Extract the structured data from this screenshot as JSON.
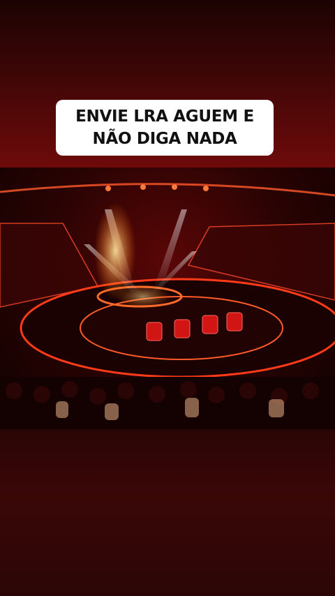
{
  "caption": {
    "text": "ENVIE LRA AGUEM E NÃO DIGA NADA"
  },
  "video": {
    "scene": "stage-with-audience",
    "colors": {
      "accent": "#ff3b1a",
      "stage": "#c21010",
      "light": "#ffd27a"
    }
  }
}
